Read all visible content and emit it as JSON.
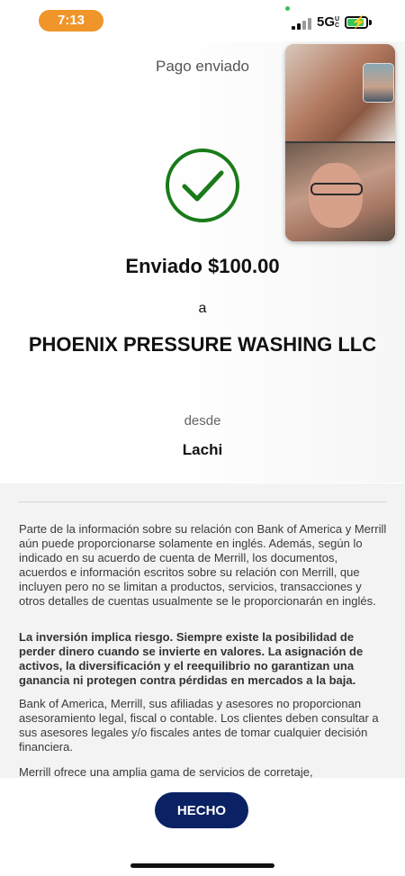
{
  "status_bar": {
    "time": "7:13",
    "network": "5G",
    "network_suffix": "UC",
    "battery_state": "charging",
    "colors": {
      "time_pill": "#f0952a",
      "battery_fill": "#35c659",
      "mic_dot": "#36c15a"
    }
  },
  "confirmation": {
    "title": "Pago enviado",
    "check_icon": "check-circle-icon",
    "sent_amount": "Enviado $100.00",
    "to_label": "a",
    "payee": "PHOENIX PRESSURE WASHING LLC",
    "from_label": "desde",
    "from_name": "Lachi",
    "accent_color": "#1a7a1a"
  },
  "video_call": {
    "icon": "video-call-overlay"
  },
  "disclaimer": {
    "paragraphs": [
      "Parte de la información sobre su relación con Bank of America y Merrill aún puede proporcionarse solamente en inglés. Además, según lo indicado en su acuerdo de cuenta de Merrill, los documentos, acuerdos e información escritos sobre su relación con Merrill, que incluyen pero no se limitan a productos, servicios, transacciones y otros detalles de cuentas usualmente se le proporcionarán en inglés.",
      "La inversión implica riesgo. Siempre existe la posibilidad de perder dinero cuando se invierte en valores. La asignación de activos, la diversificación y el reequilibrio no garantizan una ganancia ni protegen contra pérdidas en mercados a la baja.",
      "Bank of America, Merrill, sus afiliadas y asesores no proporcionan asesoramiento legal, fiscal o contable. Los clientes deben consultar a sus asesores legales y/o fiscales antes de tomar cualquier decisión financiera.",
      "Merrill ofrece una amplia gama de servicios de corretaje,"
    ]
  },
  "footer": {
    "done_label": "HECHO",
    "button_color": "#0a2164"
  }
}
